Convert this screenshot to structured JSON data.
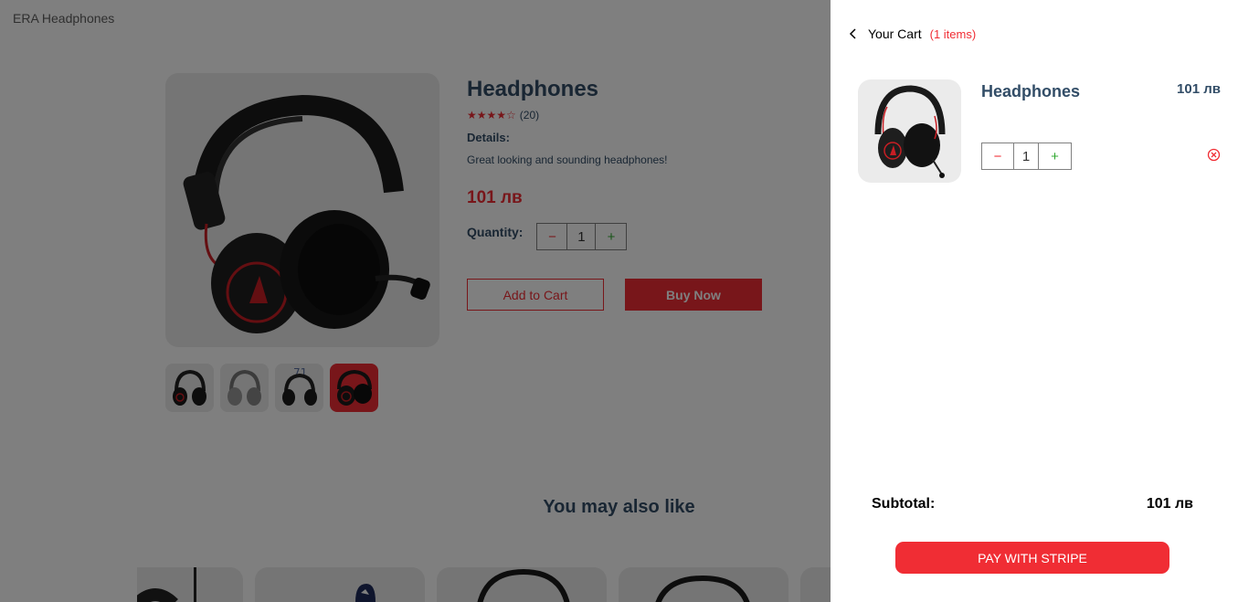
{
  "page": {
    "brand": "ERA Headphones",
    "product": {
      "title": "Headphones",
      "rating_stars": "★★★★☆",
      "review_count": "(20)",
      "details_label": "Details:",
      "details_text": "Great looking and sounding headphones!",
      "price": "101 лв",
      "quantity_label": "Quantity:",
      "quantity": "1",
      "minus": "−",
      "plus": "+",
      "add_to_cart": "Add to Cart",
      "buy_now": "Buy Now"
    },
    "also_like_title": "You may also like"
  },
  "cart": {
    "title": "Your Cart",
    "count": "(1 items)",
    "items": [
      {
        "name": "Headphones",
        "price": "101 лв",
        "quantity": "1",
        "minus": "−",
        "plus": "+"
      }
    ],
    "subtotal_label": "Subtotal:",
    "subtotal_value": "101 лв",
    "pay_button": "PAY WITH STRIPE"
  },
  "colors": {
    "accent": "#f02d34",
    "text": "#324d67",
    "image_bg": "#ebebeb",
    "plus_green": "#31a831"
  },
  "icons": [
    "back-arrow-icon",
    "star-icon",
    "minus-icon",
    "plus-icon",
    "remove-circle-icon"
  ]
}
